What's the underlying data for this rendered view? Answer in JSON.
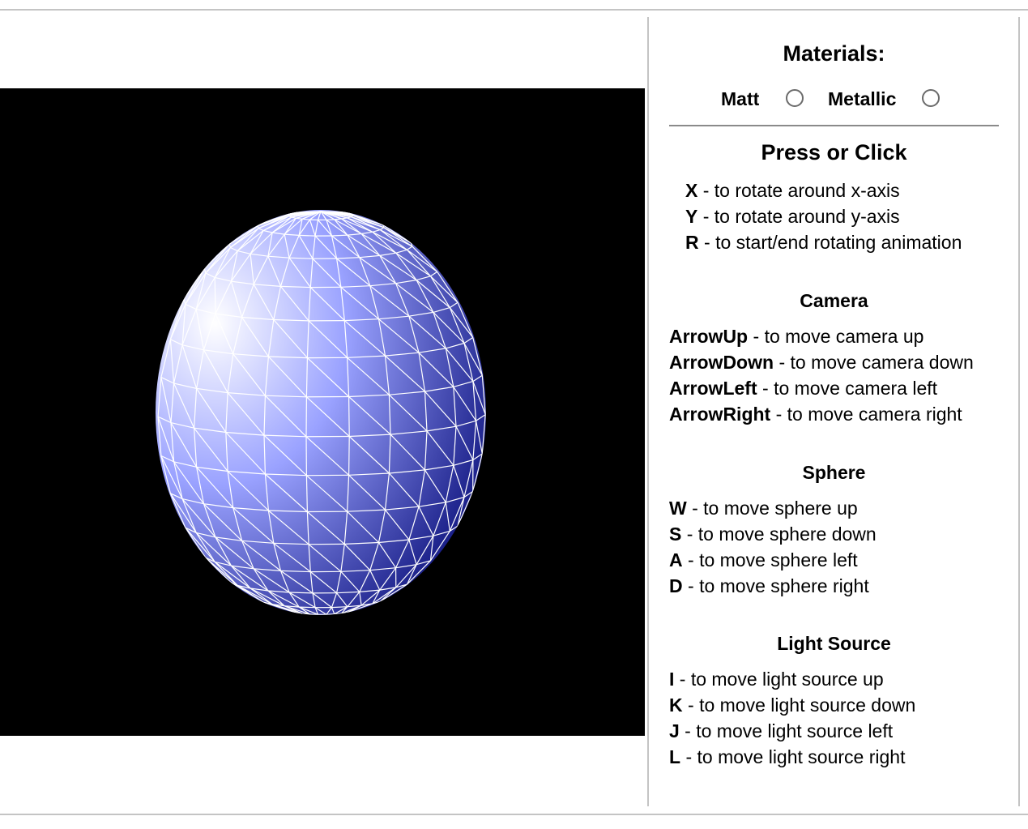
{
  "materials": {
    "title": "Materials:",
    "options": [
      {
        "label": "Matt",
        "selected": false
      },
      {
        "label": "Metallic",
        "selected": false
      }
    ]
  },
  "press": {
    "title": "Press or Click",
    "items": [
      {
        "key": "X",
        "desc": " - to rotate around x-axis"
      },
      {
        "key": "Y",
        "desc": " - to rotate around y-axis"
      },
      {
        "key": "R",
        "desc": " - to start/end rotating animation"
      }
    ]
  },
  "camera": {
    "title": "Camera",
    "items": [
      {
        "key": "ArrowUp",
        "desc": " - to move camera up"
      },
      {
        "key": "ArrowDown",
        "desc": " - to move camera down"
      },
      {
        "key": "ArrowLeft",
        "desc": " - to move camera left"
      },
      {
        "key": "ArrowRight",
        "desc": " - to move camera right"
      }
    ]
  },
  "sphere": {
    "title": "Sphere",
    "items": [
      {
        "key": "W",
        "desc": " - to move sphere up"
      },
      {
        "key": "S",
        "desc": " - to move sphere down"
      },
      {
        "key": "A",
        "desc": " - to move sphere left"
      },
      {
        "key": "D",
        "desc": " - to move sphere right"
      }
    ]
  },
  "light": {
    "title": "Light Source",
    "items": [
      {
        "key": "I",
        "desc": " - to move light source up"
      },
      {
        "key": "K",
        "desc": " - to move light source down"
      },
      {
        "key": "J",
        "desc": " - to move light source left"
      },
      {
        "key": "L",
        "desc": " - to move light source right"
      }
    ]
  },
  "scene": {
    "background": "#000000",
    "sphere_highlight": "#ffffff",
    "sphere_mid": "#9aa2ff",
    "sphere_shadow": "#0a0f7a",
    "wireframe": "#ffffff"
  }
}
